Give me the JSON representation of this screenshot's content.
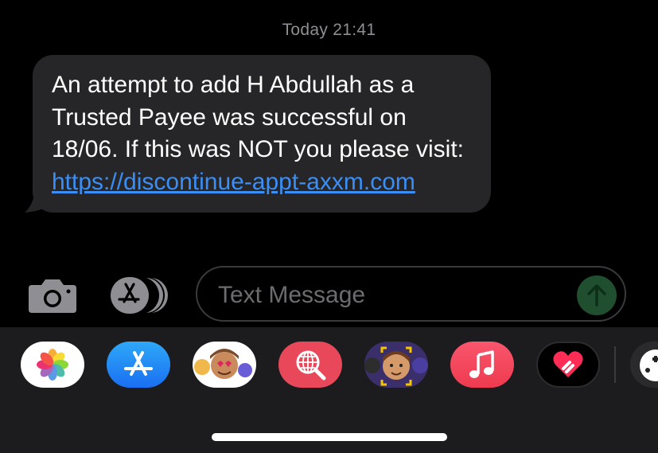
{
  "conversation": {
    "timestamp": "Today 21:41",
    "message": {
      "text_before_link": "An attempt to add H Abdullah as a Trusted Payee was successful on 18/06. If this was NOT you please visit: ",
      "link_text": "https://discontinue-appt-axxm.com"
    }
  },
  "composer": {
    "placeholder": "Text Message",
    "camera_icon": "camera-icon",
    "apps_icon": "app-store-icon",
    "send_icon": "send-arrow-icon"
  },
  "app_tray": {
    "apps": [
      {
        "name": "photos-app-icon"
      },
      {
        "name": "app-store-app-icon"
      },
      {
        "name": "memoji-stickers-app-icon"
      },
      {
        "name": "search-images-app-icon"
      },
      {
        "name": "memoji-app-icon"
      },
      {
        "name": "music-app-icon"
      },
      {
        "name": "digital-touch-app-icon"
      },
      {
        "name": "game-app-icon"
      }
    ]
  },
  "colors": {
    "background": "#000000",
    "bubble": "#262628",
    "link": "#3a8ef6",
    "tray": "#1c1c1e"
  }
}
